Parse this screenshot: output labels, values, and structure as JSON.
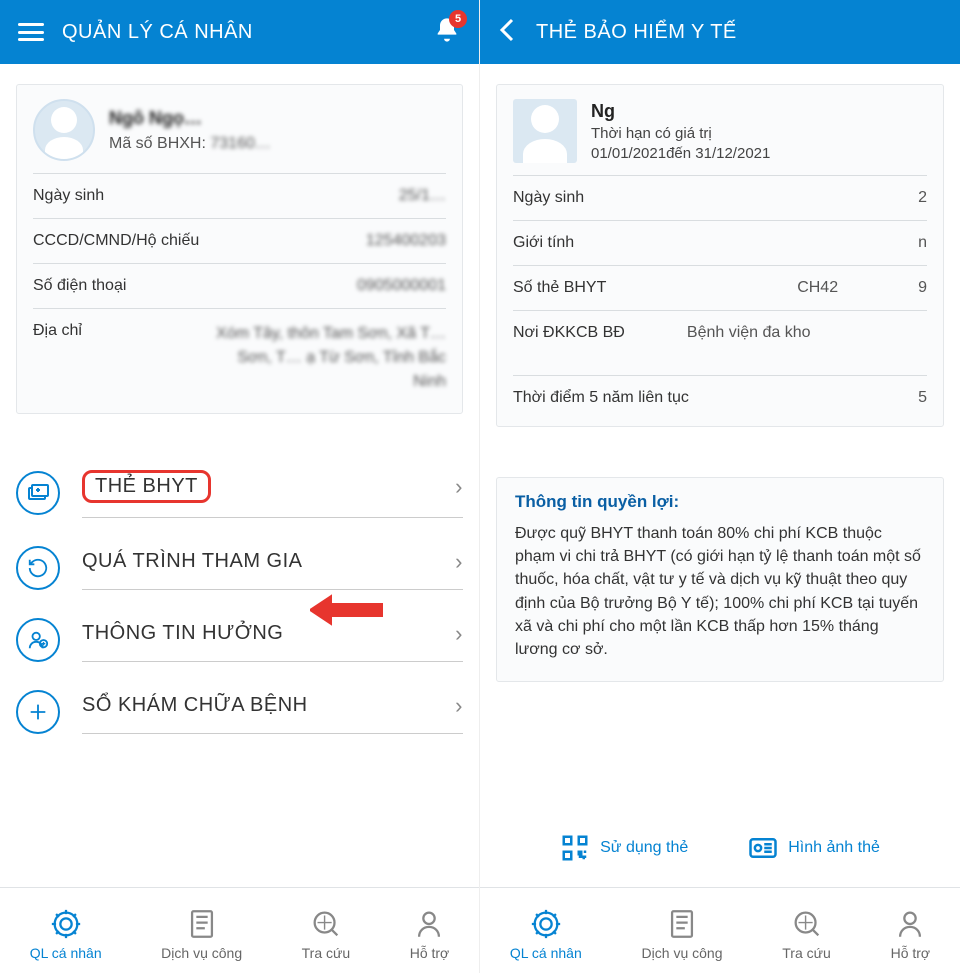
{
  "left": {
    "header": {
      "title": "QUẢN LÝ CÁ NHÂN",
      "badge": "5"
    },
    "profile": {
      "name": "Ngô Ngọ…",
      "bhxh_label": "Mã số BHXH:",
      "bhxh_value": "73160…"
    },
    "rows": {
      "dob_label": "Ngày sinh",
      "dob_value": "25/1…",
      "idcard_label": "CCCD/CMND/Hộ chiếu",
      "idcard_value": "125400203",
      "phone_label": "Số điện thoại",
      "phone_value": "0905000001",
      "addr_label": "Địa chỉ",
      "addr_value": "Xóm Tây, thôn Tam Sơn, Xã T…\nSơn, T… ạ Từ Sơn, Tỉnh Bắc\nNinh"
    },
    "menu": {
      "bhyt": "THẺ BHYT",
      "process": "QUÁ TRÌNH THAM GIA",
      "benefit": "THÔNG TIN HƯỞNG",
      "medical": "SỔ KHÁM CHỮA BỆNH"
    }
  },
  "right": {
    "header": {
      "title": "THẺ BẢO HIỂM Y TẾ"
    },
    "profile": {
      "name": "Ng",
      "valid_label": "Thời hạn có giá trị",
      "valid_value": "01/01/2021đến 31/12/2021"
    },
    "rows": {
      "dob_label": "Ngày sinh",
      "dob_value": "2",
      "gender_label": "Giới tính",
      "gender_value": "n",
      "card_label": "Số thẻ BHYT",
      "card_value_a": "CH42",
      "card_value_b": "9",
      "hospital_label": "Nơi ĐKKCB BĐ",
      "hospital_value": "Bệnh viện đa kho",
      "five_label": "Thời điểm 5 năm liên tục",
      "five_value": "5"
    },
    "benefits": {
      "title": "Thông tin quyền lợi:",
      "text": "Được quỹ BHYT thanh toán 80% chi phí KCB thuộc phạm vi chi trả BHYT (có giới hạn tỷ lệ thanh toán một số thuốc, hóa chất, vật tư y tế và dịch vụ kỹ thuật theo quy định của Bộ trưởng Bộ Y tế); 100% chi phí KCB tại tuyến xã và chi phí cho một lần KCB thấp hơn 15% tháng lương cơ sở."
    },
    "actions": {
      "use": "Sử dụng thẻ",
      "image": "Hình ảnh thẻ"
    }
  },
  "nav": {
    "personal": "QL cá nhân",
    "service": "Dịch vụ công",
    "search": "Tra cứu",
    "support": "Hỗ trợ"
  }
}
